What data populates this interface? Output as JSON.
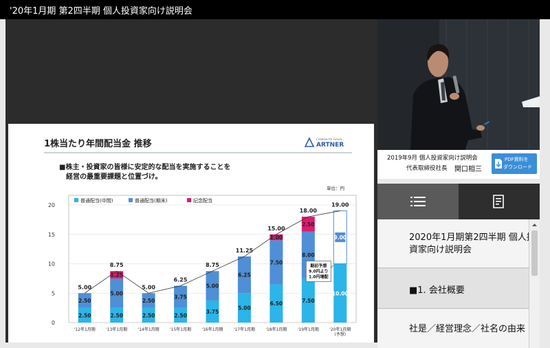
{
  "window": {
    "title": "'20年1月期 第2四半期 個人投資家向け説明会"
  },
  "slide": {
    "heading": "1株当たり年間配当金 推移",
    "logo_small": "Creative for Future",
    "logo": "ARTNER",
    "bullet_line1": "■株主・投資家の皆様に安定的な配当を実施することを",
    "bullet_line2": "経営の最重要課題と位置づけ。",
    "unit": "単位：円",
    "callout_lines": [
      "期初予想",
      "9.0円より",
      "1.0円増配"
    ]
  },
  "chart_data": {
    "type": "bar",
    "stacked": true,
    "categories": [
      "'12年1月期",
      "'13年1月期",
      "'14年1月期",
      "'15年1月期",
      "'16年1月期",
      "'17年1月期",
      "'18年1月期",
      "'19年1月期",
      "'20年1月期"
    ],
    "forecast_label": "(予想)",
    "series": [
      {
        "name": "普通配当(中間)",
        "color": "#2bb5e8",
        "values": [
          2.5,
          2.5,
          2.5,
          2.5,
          3.75,
          5.0,
          6.5,
          7.5,
          10.0
        ]
      },
      {
        "name": "普通配当(期末)",
        "color": "#4f8fd6",
        "values": [
          2.5,
          5.0,
          2.5,
          3.75,
          5.0,
          6.25,
          7.5,
          8.0,
          9.0
        ]
      },
      {
        "name": "記念配当",
        "color": "#e0196e",
        "values": [
          0,
          1.25,
          0,
          0,
          0,
          0,
          1.0,
          2.5,
          0
        ]
      }
    ],
    "totals": [
      5.0,
      8.75,
      5.0,
      6.25,
      8.75,
      11.25,
      15.0,
      18.0,
      19.0
    ],
    "ylim": [
      0,
      20
    ],
    "yticks": [
      0,
      5,
      10,
      15,
      20
    ],
    "grid": true,
    "legend_position": "top-left"
  },
  "video_caption": {
    "line1": "2019年9月 個人投資家向け説明会",
    "line2_prefix": "代表取締役社長",
    "line2_name": "関口相三",
    "pdf_button_line1": "PDF資料を",
    "pdf_button_line2": "ダウンロード"
  },
  "tabs": [
    {
      "icon": "list-icon",
      "active": true
    },
    {
      "icon": "document-icon",
      "active": false
    }
  ],
  "chapters": [
    "2020年1月期第2四半期 個人投資家向け説明会",
    "■1. 会社概要",
    "社是／経営理念／社名の由来"
  ],
  "colors": {
    "active_tab": "#5a5a5a",
    "inactive_tab": "#2e2e2e",
    "pdf_button": "#3c8ed8"
  }
}
